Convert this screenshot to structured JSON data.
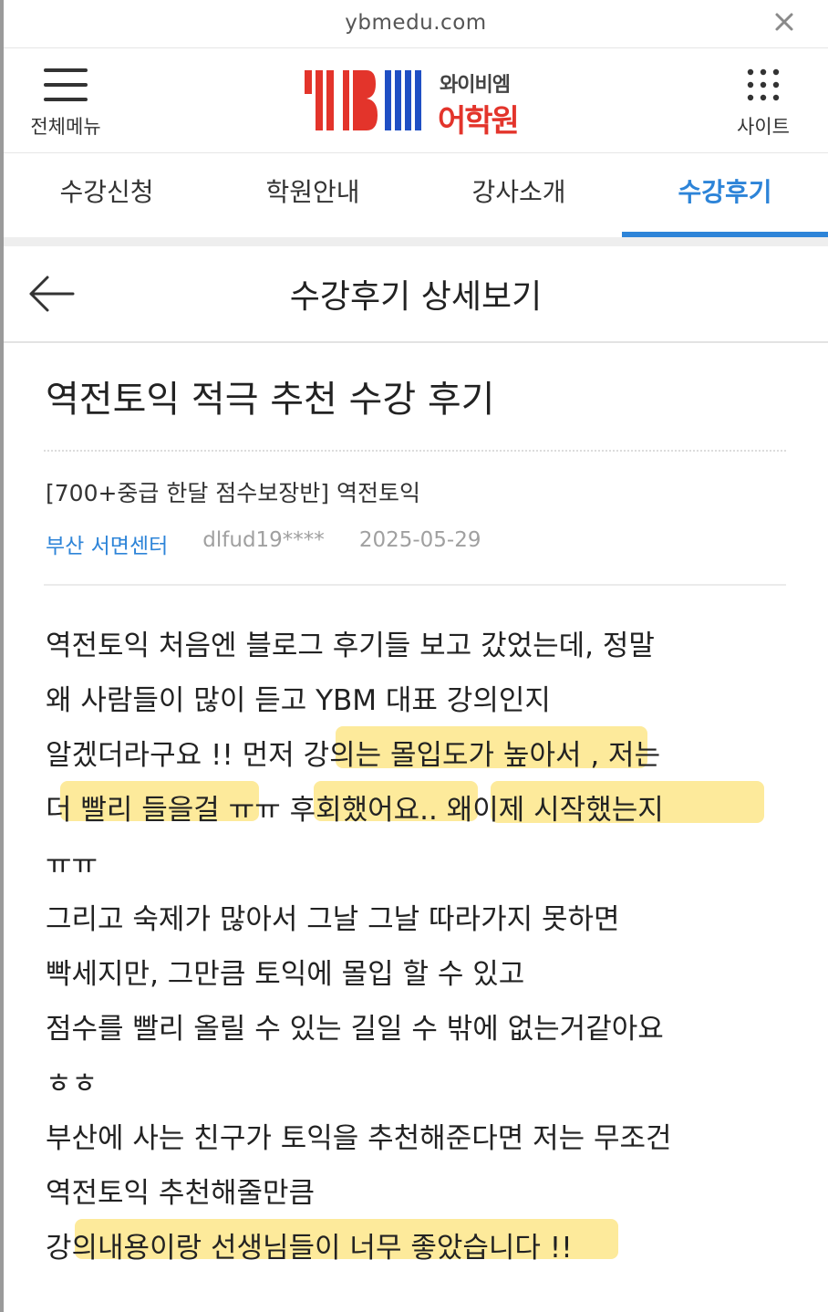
{
  "url": "ybmedu.com",
  "header": {
    "menu_label": "전체메뉴",
    "logo_mark": "YBM",
    "logo_sub": "와이비엠",
    "logo_main": "어학원",
    "site_label": "사이트"
  },
  "nav": {
    "tabs": [
      {
        "label": "수강신청"
      },
      {
        "label": "학원안내"
      },
      {
        "label": "강사소개"
      },
      {
        "label": "수강후기",
        "active": true
      }
    ]
  },
  "page": {
    "title": "수강후기 상세보기"
  },
  "review": {
    "title": "역전토익 적극 추천 수강 후기",
    "course": "[700+중급 한달 점수보장반] 역전토익",
    "center": "부산 서면센터",
    "user": "dlfud19****",
    "date": "2025-05-29",
    "lines": [
      "역전토익 처음엔 블로그 후기들 보고 갔었는데, 정말",
      "왜 사람들이 많이 듣고 YBM 대표 강의인지",
      "알겠더라구요 !! 먼저 강의는 몰입도가 높아서 , 저는",
      "더 빨리 들을걸 ㅠㅠ 후회했어요.. 왜이제 시작했는지",
      "ㅠㅠ",
      "그리고 숙제가 많아서 그날 그날 따라가지 못하면",
      "빡세지만, 그만큼 토익에 몰입 할 수 있고",
      "점수를 빨리 올릴 수 있는 길일 수 밖에 없는거같아요",
      "ㅎㅎ",
      "부산에 사는 친구가 토익을 추천해준다면 저는 무조건",
      "역전토익 추천해줄만큼",
      "강의내용이랑 선생님들이 너무 좋았습니다 !!"
    ]
  },
  "colors": {
    "accent": "#2d84d8",
    "brand_red": "#e3342b",
    "brand_blue": "#1f4fc4",
    "highlight": "#fde68a"
  },
  "icons": {
    "close": "close-icon",
    "menu": "hamburger-icon",
    "site": "grid-icon",
    "back": "back-arrow-icon"
  }
}
